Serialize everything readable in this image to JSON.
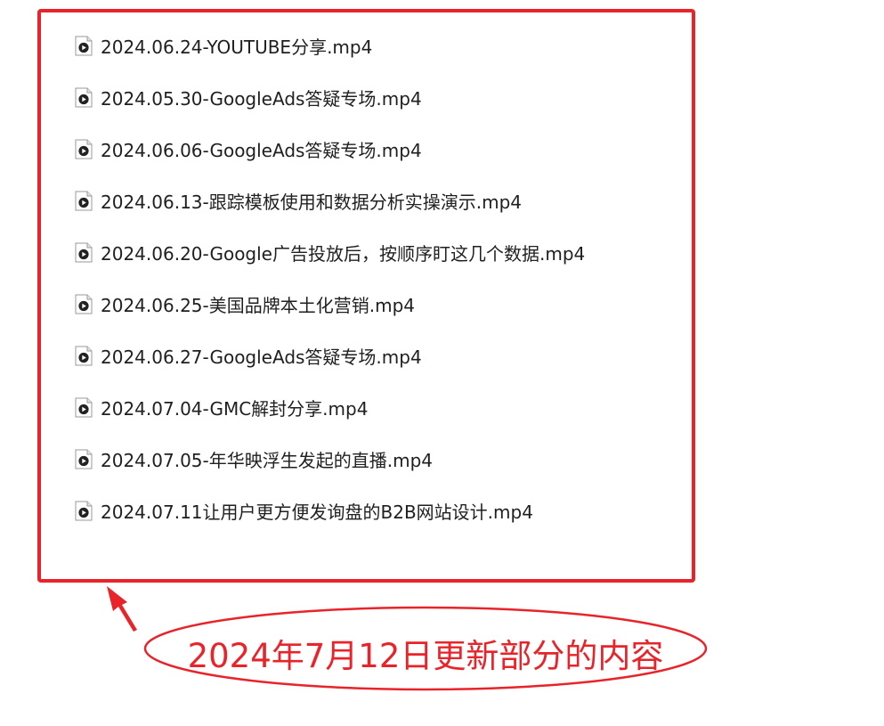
{
  "files": [
    {
      "name": "2024.06.24-YOUTUBE分享.mp4"
    },
    {
      "name": "2024.05.30-GoogleAds答疑专场.mp4"
    },
    {
      "name": "2024.06.06-GoogleAds答疑专场.mp4"
    },
    {
      "name": "2024.06.13-跟踪模板使用和数据分析实操演示.mp4"
    },
    {
      "name": "2024.06.20-Google广告投放后，按顺序盯这几个数据.mp4"
    },
    {
      "name": "2024.06.25-美国品牌本土化营销.mp4"
    },
    {
      "name": "2024.06.27-GoogleAds答疑专场.mp4"
    },
    {
      "name": "2024.07.04-GMC解封分享.mp4"
    },
    {
      "name": "2024.07.05-年华映浮生发起的直播.mp4"
    },
    {
      "name": "2024.07.11让用户更方便发询盘的B2B网站设计.mp4"
    }
  ],
  "annotation": {
    "label": "2024年7月12日更新部分的内容"
  },
  "colors": {
    "annotation_red": "#e8242a",
    "file_text": "#1f1f1f"
  },
  "icons": {
    "file": "video-file-icon",
    "arrow": "arrow-icon"
  }
}
